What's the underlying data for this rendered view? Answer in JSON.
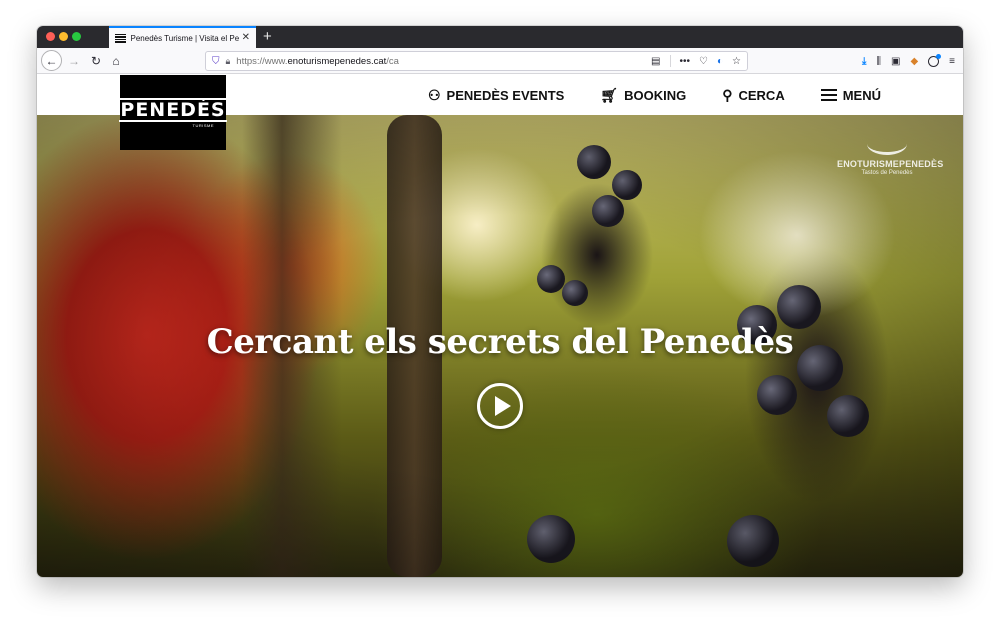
{
  "browser": {
    "tab_title": "Penedès Turisme | Visita el Penedès",
    "tab_close": "✕",
    "new_tab": "+",
    "url_scheme": "https://www.",
    "url_domain": "enoturismepenedes.cat",
    "url_path": "/ca"
  },
  "site": {
    "logo_text": "PENEDÈS",
    "logo_sub": "TURISME",
    "nav": [
      {
        "label": "PENEDÈS EVENTS",
        "icon": "people-group-icon"
      },
      {
        "label": "BOOKING",
        "icon": "cart-icon"
      },
      {
        "label": "CERCA",
        "icon": "search-icon"
      },
      {
        "label": "MENÚ",
        "icon": "hamburger-icon"
      }
    ]
  },
  "hero": {
    "title": "Cercant els secrets del Penedès",
    "watermark_name": "ENOTURISMEPENEDÈS",
    "watermark_sub": "Tastos de Penedès"
  }
}
